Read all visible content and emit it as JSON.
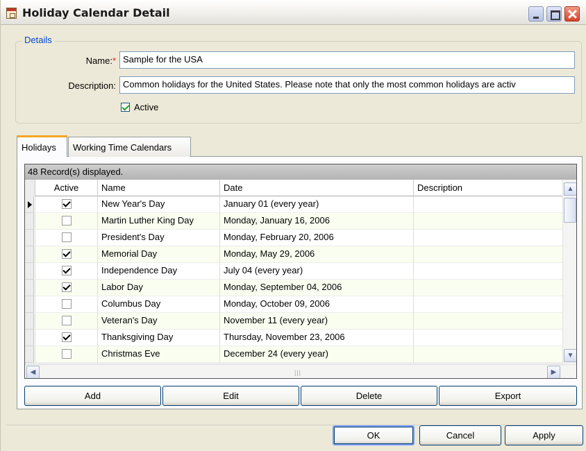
{
  "window": {
    "title": "Holiday Calendar Detail"
  },
  "details": {
    "legend": "Details",
    "name_label": "Name:",
    "required_mark": "*",
    "name_value": "Sample for the USA",
    "description_label": "Description:",
    "description_value": "Common holidays for the United States. Please note that only the most common holidays are activ",
    "active_label": "Active",
    "active_checked": true
  },
  "tabs": [
    {
      "label": "Holidays",
      "active": true
    },
    {
      "label": "Working Time Calendars",
      "active": false
    }
  ],
  "grid": {
    "caption": "48 Record(s) displayed.",
    "columns": [
      "Active",
      "Name",
      "Date",
      "Description"
    ],
    "rows": [
      {
        "active": true,
        "name": "New Year's Day",
        "date": "January 01 (every year)",
        "description": "",
        "current": true
      },
      {
        "active": false,
        "name": "Martin Luther King Day",
        "date": "Monday, January 16, 2006",
        "description": ""
      },
      {
        "active": false,
        "name": "President's Day",
        "date": "Monday, February 20, 2006",
        "description": ""
      },
      {
        "active": true,
        "name": "Memorial Day",
        "date": "Monday, May 29, 2006",
        "description": ""
      },
      {
        "active": true,
        "name": "Independence Day",
        "date": "July 04 (every year)",
        "description": ""
      },
      {
        "active": true,
        "name": "Labor Day",
        "date": "Monday, September 04, 2006",
        "description": ""
      },
      {
        "active": false,
        "name": "Columbus Day",
        "date": "Monday, October 09, 2006",
        "description": ""
      },
      {
        "active": false,
        "name": "Veteran's Day",
        "date": "November 11 (every year)",
        "description": ""
      },
      {
        "active": true,
        "name": "Thanksgiving Day",
        "date": "Thursday, November 23, 2006",
        "description": ""
      },
      {
        "active": false,
        "name": "Christmas Eve",
        "date": "December 24 (every year)",
        "description": ""
      }
    ]
  },
  "grid_buttons": {
    "add": "Add",
    "edit": "Edit",
    "delete": "Delete",
    "export": "Export"
  },
  "dialog_buttons": {
    "ok": "OK",
    "cancel": "Cancel",
    "apply": "Apply"
  },
  "icons": {
    "window": "calendar-icon",
    "minimize": "minimize-icon",
    "maximize": "maximize-icon",
    "close": "close-icon",
    "current_row": "row-pointer-icon"
  },
  "colors": {
    "window_bg": "#ece9d8",
    "group_legend": "#0046d5",
    "required": "#e02020",
    "active_tab_accent": "#f5a623",
    "row_alt": "#fafef0"
  }
}
